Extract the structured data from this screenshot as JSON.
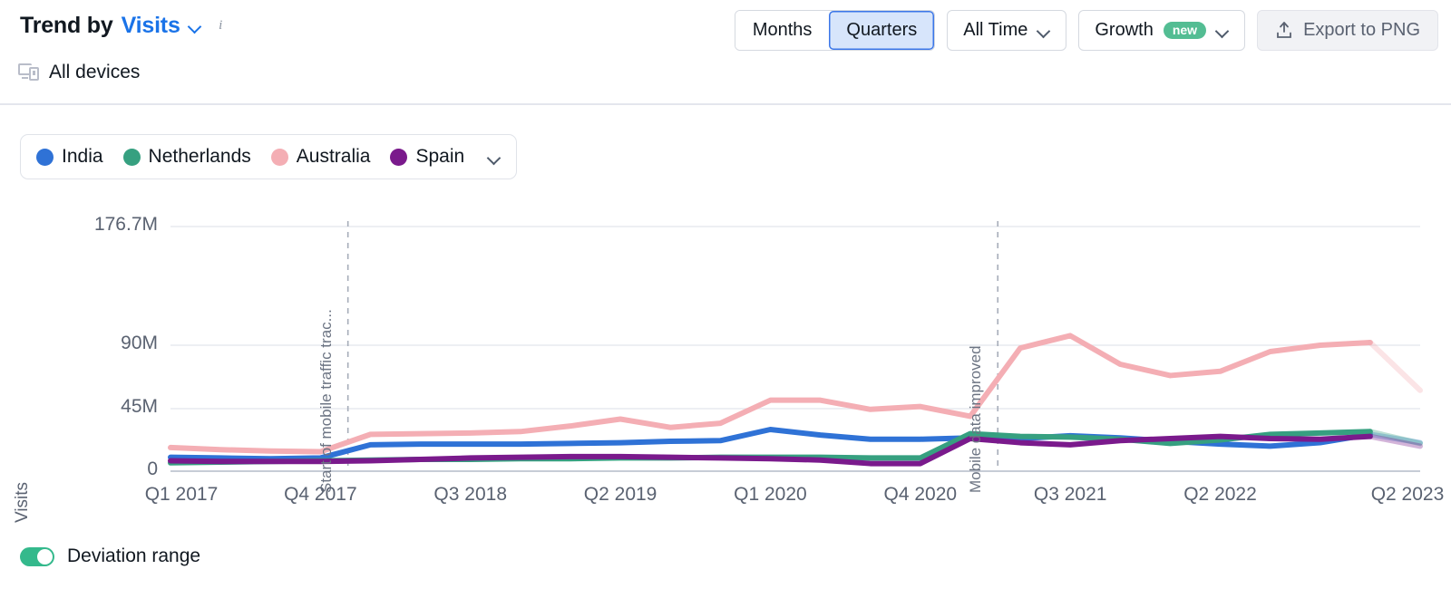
{
  "header": {
    "title_prefix": "Trend by",
    "title_metric": "Visits",
    "metric_caret_icon": "chevron-down-icon",
    "info_icon": "info-icon",
    "devices_icon": "all-devices-icon",
    "devices_label": "All devices"
  },
  "toolbar": {
    "granularity": {
      "options": [
        "Months",
        "Quarters"
      ],
      "selected": "Quarters"
    },
    "date_range": {
      "label": "All Time",
      "caret_icon": "chevron-down-icon"
    },
    "mode": {
      "label": "Growth",
      "badge": "new",
      "caret_icon": "chevron-down-icon"
    },
    "export": {
      "label": "Export to PNG",
      "icon": "export-upload-icon"
    }
  },
  "legend": {
    "items": [
      {
        "label": "India",
        "color": "#2f72d6"
      },
      {
        "label": "Netherlands",
        "color": "#36a080"
      },
      {
        "label": "Australia",
        "color": "#f4aeb4"
      },
      {
        "label": "Spain",
        "color": "#7a1a8c"
      }
    ],
    "caret_icon": "chevron-down-icon"
  },
  "footer": {
    "deviation_toggle_label": "Deviation range",
    "deviation_toggle_on": true,
    "toggle_color": "#34b98c"
  },
  "chart_data": {
    "type": "line",
    "title": "Trend by Visits",
    "xlabel": "",
    "ylabel": "Visits",
    "grid": true,
    "legend_position": "top-left",
    "ylim": [
      0,
      176700000
    ],
    "y_ticks": [
      {
        "label": "176.7M",
        "value": 176700000
      },
      {
        "label": "90M",
        "value": 90000000
      },
      {
        "label": "45M",
        "value": 45000000
      },
      {
        "label": "0",
        "value": 0
      }
    ],
    "x_tick_labels": [
      "Q1 2017",
      "Q4 2017",
      "Q3 2018",
      "Q2 2019",
      "Q1 2020",
      "Q4 2020",
      "Q3 2021",
      "Q2 2022",
      "Q2 2023"
    ],
    "x_tick_indices": [
      0,
      3,
      6,
      9,
      12,
      15,
      18,
      21,
      25
    ],
    "categories": [
      "Q1 2017",
      "Q2 2017",
      "Q3 2017",
      "Q4 2017",
      "Q1 2018",
      "Q2 2018",
      "Q3 2018",
      "Q4 2018",
      "Q1 2019",
      "Q2 2019",
      "Q3 2019",
      "Q4 2019",
      "Q1 2020",
      "Q2 2020",
      "Q3 2020",
      "Q4 2020",
      "Q1 2021",
      "Q2 2021",
      "Q3 2021",
      "Q4 2021",
      "Q1 2022",
      "Q2 2022",
      "Q3 2022",
      "Q4 2022",
      "Q1 2023",
      "Q2 2023"
    ],
    "forecast_from_index": 24,
    "series": [
      {
        "name": "India",
        "color": "#2f72d6",
        "values": [
          10.0,
          9.5,
          9.0,
          9.5,
          19.0,
          19.5,
          19.5,
          19.5,
          20.0,
          20.5,
          21.5,
          22.0,
          30.0,
          26.0,
          23.0,
          23.0,
          24.0,
          23.5,
          25.5,
          24.0,
          21.5,
          19.5,
          18.0,
          20.5,
          26.5,
          20.5
        ]
      },
      {
        "name": "Netherlands",
        "color": "#36a080",
        "values": [
          6.0,
          6.5,
          7.0,
          7.5,
          8.0,
          8.5,
          8.5,
          9.0,
          9.0,
          9.5,
          9.5,
          10.0,
          10.0,
          10.0,
          9.5,
          9.5,
          27.0,
          25.0,
          24.5,
          23.0,
          20.0,
          22.5,
          26.5,
          27.5,
          28.5,
          20.0
        ]
      },
      {
        "name": "Australia",
        "color": "#f4aeb4",
        "values": [
          17.0,
          15.5,
          14.5,
          14.0,
          26.5,
          27.0,
          27.5,
          28.5,
          32.5,
          37.5,
          31.5,
          34.5,
          51.0,
          51.0,
          44.5,
          46.5,
          39.5,
          88.0,
          97.0,
          76.5,
          68.5,
          71.5,
          85.5,
          90.0,
          92.0,
          58.0
        ]
      },
      {
        "name": "Spain",
        "color": "#7a1a8c",
        "values": [
          7.5,
          7.0,
          7.0,
          7.0,
          7.5,
          8.5,
          9.5,
          10.0,
          10.5,
          10.5,
          10.0,
          9.5,
          9.0,
          8.0,
          5.5,
          5.5,
          23.5,
          20.5,
          19.0,
          22.0,
          23.5,
          25.0,
          23.5,
          23.0,
          25.0,
          18.0
        ]
      }
    ],
    "annotations": [
      {
        "text": "Start of mobile traffic trac...",
        "at_index": 3.55,
        "style": "dashed-vertical"
      },
      {
        "text": "Mobile data improved",
        "at_index": 16.55,
        "style": "dashed-vertical"
      }
    ]
  }
}
